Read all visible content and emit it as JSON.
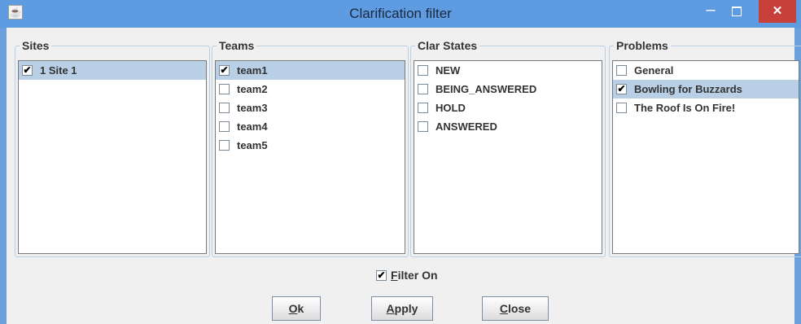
{
  "window": {
    "title": "Clarification filter",
    "app_icon": "java-cup-icon",
    "close_glyph": "✕"
  },
  "panels": {
    "sites": {
      "title": "Sites",
      "items": [
        {
          "label": "1 Site 1",
          "checked": true,
          "selected": true
        }
      ]
    },
    "teams": {
      "title": "Teams",
      "items": [
        {
          "label": "team1",
          "checked": true,
          "selected": true
        },
        {
          "label": "team2",
          "checked": false,
          "selected": false
        },
        {
          "label": "team3",
          "checked": false,
          "selected": false
        },
        {
          "label": "team4",
          "checked": false,
          "selected": false
        },
        {
          "label": "team5",
          "checked": false,
          "selected": false
        }
      ]
    },
    "clar_states": {
      "title": "Clar States",
      "items": [
        {
          "label": "NEW",
          "checked": false,
          "selected": false
        },
        {
          "label": "BEING_ANSWERED",
          "checked": false,
          "selected": false
        },
        {
          "label": "HOLD",
          "checked": false,
          "selected": false
        },
        {
          "label": "ANSWERED",
          "checked": false,
          "selected": false
        }
      ]
    },
    "problems": {
      "title": "Problems",
      "items": [
        {
          "label": "General",
          "checked": false,
          "selected": false
        },
        {
          "label": "Bowling for Buzzards",
          "checked": true,
          "selected": true
        },
        {
          "label": "The Roof Is On Fire!",
          "checked": false,
          "selected": false
        }
      ]
    }
  },
  "filter_on": {
    "mnemonic": "F",
    "rest": "ilter On",
    "checked": true
  },
  "buttons": {
    "ok": {
      "mnemonic": "O",
      "rest": "k"
    },
    "apply": {
      "mnemonic": "A",
      "rest": "pply"
    },
    "close": {
      "mnemonic": "C",
      "rest": "lose"
    }
  },
  "checkmark": "✔",
  "colors": {
    "titlebar": "#5f9be0",
    "selection": "#b8cfe5",
    "close_button": "#c7413a",
    "dialog_bg": "#f0f0f0"
  }
}
